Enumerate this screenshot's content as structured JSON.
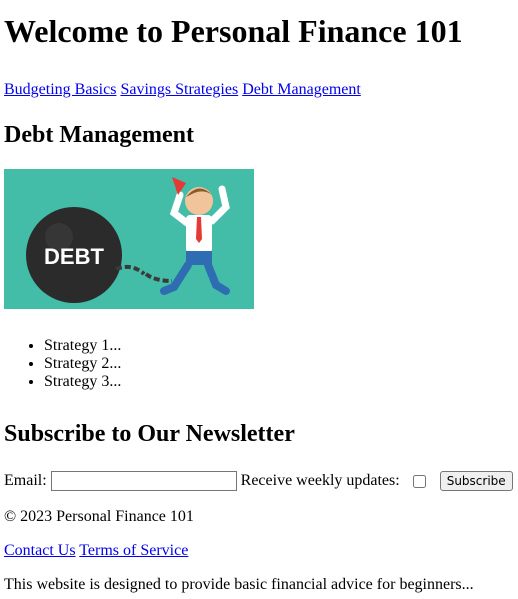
{
  "header": {
    "title": "Welcome to Personal Finance 101"
  },
  "nav": {
    "items": [
      {
        "label": "Budgeting Basics"
      },
      {
        "label": "Savings Strategies"
      },
      {
        "label": "Debt Management"
      }
    ]
  },
  "debt_section": {
    "heading": "Debt Management",
    "image_text": "DEBT",
    "strategies": [
      "Strategy 1...",
      "Strategy 2...",
      "Strategy 3..."
    ]
  },
  "newsletter": {
    "heading": "Subscribe to Our Newsletter",
    "email_label": "Email:",
    "email_value": "",
    "updates_label": "Receive weekly updates:",
    "updates_checked": false,
    "subscribe_label": "Subscribe"
  },
  "footer": {
    "copyright": "© 2023 Personal Finance 101",
    "links": [
      {
        "label": "Contact Us"
      },
      {
        "label": "Terms of Service"
      }
    ],
    "note": "This website is designed to provide basic financial advice for beginners..."
  },
  "colors": {
    "link": "#0000ee",
    "hero_background": "#43bca8",
    "ball": "#2b2b2b",
    "shirt": "#ffffff",
    "tie": "#e53935",
    "pants": "#2f6db2",
    "chain": "#3a3a3a"
  }
}
